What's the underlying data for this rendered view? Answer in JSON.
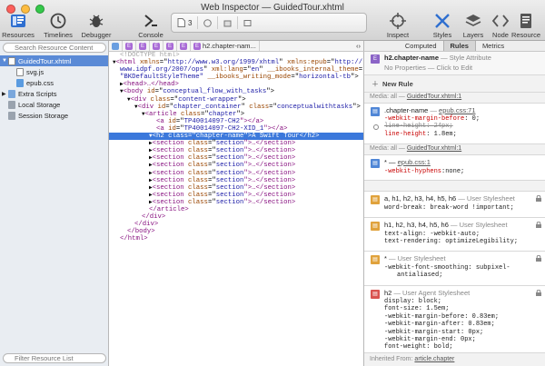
{
  "window": {
    "title": "Web Inspector — GuidedTour.xhtml"
  },
  "toolbar": {
    "resources": "Resources",
    "timelines": "Timelines",
    "debugger": "Debugger",
    "console": "Console",
    "activity_count": "3",
    "inspect": "Inspect",
    "styles": "Styles",
    "layers": "Layers",
    "node": "Node",
    "resource": "Resource"
  },
  "sidebar": {
    "search_placeholder": "Search Resource Content",
    "filter_placeholder": "Filter Resource List",
    "items": [
      {
        "label": "GuidedTour.xhtml",
        "selected": true
      },
      {
        "label": "svg.js"
      },
      {
        "label": "epub.css"
      },
      {
        "label": "Extra Scripts"
      },
      {
        "label": "Local Storage"
      },
      {
        "label": "Session Storage"
      }
    ]
  },
  "breadcrumb": {
    "last": "h2.chapter-nam..."
  },
  "dom": {
    "l0": "<!DOCTYPE html>",
    "l1a": "<html ",
    "l1b": "xmlns",
    "l1c": "=\"",
    "l1d": "http://www.w3.org/1999/xhtml",
    "l1e": "\" ",
    "l1f": "xmlns:epub",
    "l1g": "=\"",
    "l1h": "http://",
    "l2a": "www.idpf.org/2007/ops",
    "l2b": "\" ",
    "l2c": "xml:lang",
    "l2d": "=\"",
    "l2e": "en",
    "l2f": "\" ",
    "l2g": "__ibooks_internal_theme",
    "l2h": "=",
    "l3a": "\"BKDefaultStyleTheme\" ",
    "l3b": "__ibooks_writing_mode",
    "l3c": "=\"",
    "l3d": "horizontal-tb",
    "l3e": "\">",
    "l4": "<head>…</head>",
    "l5a": "<body ",
    "l5b": "id",
    "l5c": "=\"",
    "l5d": "conceptual_flow_with_tasks",
    "l5e": "\">",
    "l6a": "<div ",
    "l6b": "class",
    "l6c": "=\"",
    "l6d": "content-wrapper",
    "l6e": "\">",
    "l7a": "<div ",
    "l7b": "id",
    "l7c": "=\"",
    "l7d": "chapter_container",
    "l7e": "\" ",
    "l7f": "class",
    "l7g": "=\"",
    "l7h": "conceptualwithtasks",
    "l7i": "\">",
    "l8a": "<article ",
    "l8b": "class",
    "l8c": "=\"",
    "l8d": "chapter",
    "l8e": "\">",
    "l9a": "<a ",
    "l9b": "id",
    "l9c": "=\"",
    "l9d": "TP40014097-CH2",
    "l9e": "\"></a>",
    "l10a": "<a ",
    "l10b": "id",
    "l10c": "=\"",
    "l10d": "TP40014097-CH2-XID_1",
    "l10e": "\"></a>",
    "l11a": "<h2 ",
    "l11b": "class",
    "l11c": "=\"",
    "l11d": "chapter-name",
    "l11e": "\">",
    "l11f": "A Swift Tour",
    "l11g": "</h2>",
    "sec_open": "<section ",
    "sec_attr": "class",
    "sec_eq": "=\"",
    "sec_val": "section",
    "sec_close": "\">…</section>",
    "l20": "</article>",
    "l21": "</div>",
    "l22": "</div>",
    "l23": "</body>",
    "l24": "</html>"
  },
  "tabs": {
    "computed": "Computed",
    "rules": "Rules",
    "metrics": "Metrics"
  },
  "styles": {
    "s1_sel": "h2.chapter-name",
    "s1_meta": "— Style Attribute",
    "s1_body": "No Properties — Click to Edit",
    "new_rule": "New Rule",
    "media": "Media: all —",
    "media_link": "GuidedTour.xhtml:1",
    "r1_sel": ".chapter-name",
    "r1_src": "epub.css:71",
    "r1_p1n": "-webkit-margin-before",
    "r1_p1v": "0;",
    "r1_p2n": "line-height",
    "r1_p2v": "24px;",
    "r1_p3n": "line-height",
    "r1_p3v": "1.8em;",
    "r2_sel": "* —",
    "r2_src": "epub.css:1",
    "r2_p1n": "-webkit-hyphens",
    "r2_p1v": "none;",
    "r3_sel": "a, h1, h2, h3, h4, h5, h6",
    "r3_src": "— User Stylesheet",
    "r3_p1": "word-break: break-word !important;",
    "r4_sel": "h1, h2, h3, h4, h5, h6",
    "r4_src": "— User Stylesheet",
    "r4_p1": "text-align: -webkit-auto;",
    "r4_p2": "text-rendering: optimizeLegibility;",
    "r5_sel": "*",
    "r5_src": "— User Stylesheet",
    "r5_p1": "-webkit-font-smoothing: subpixel-",
    "r5_p2": "antialiased;",
    "r6_sel": "h2",
    "r6_src": "— User Agent Stylesheet",
    "r6_p1": "display: block;",
    "r6_p2": "font-size: 1.5em;",
    "r6_p3": "-webkit-margin-before: 0.83em;",
    "r6_p4": "-webkit-margin-after: 0.83em;",
    "r6_p5": "-webkit-margin-start: 0px;",
    "r6_p6": "-webkit-margin-end: 0px;",
    "r6_p7": "font-weight: bold;",
    "inherited": "Inherited From:",
    "inherited_link": "article.chapter"
  },
  "colors": {
    "accent": "#3b78db",
    "tag": "#881280",
    "attr": "#994500",
    "value": "#1a1aa6",
    "property": "#c80000"
  }
}
